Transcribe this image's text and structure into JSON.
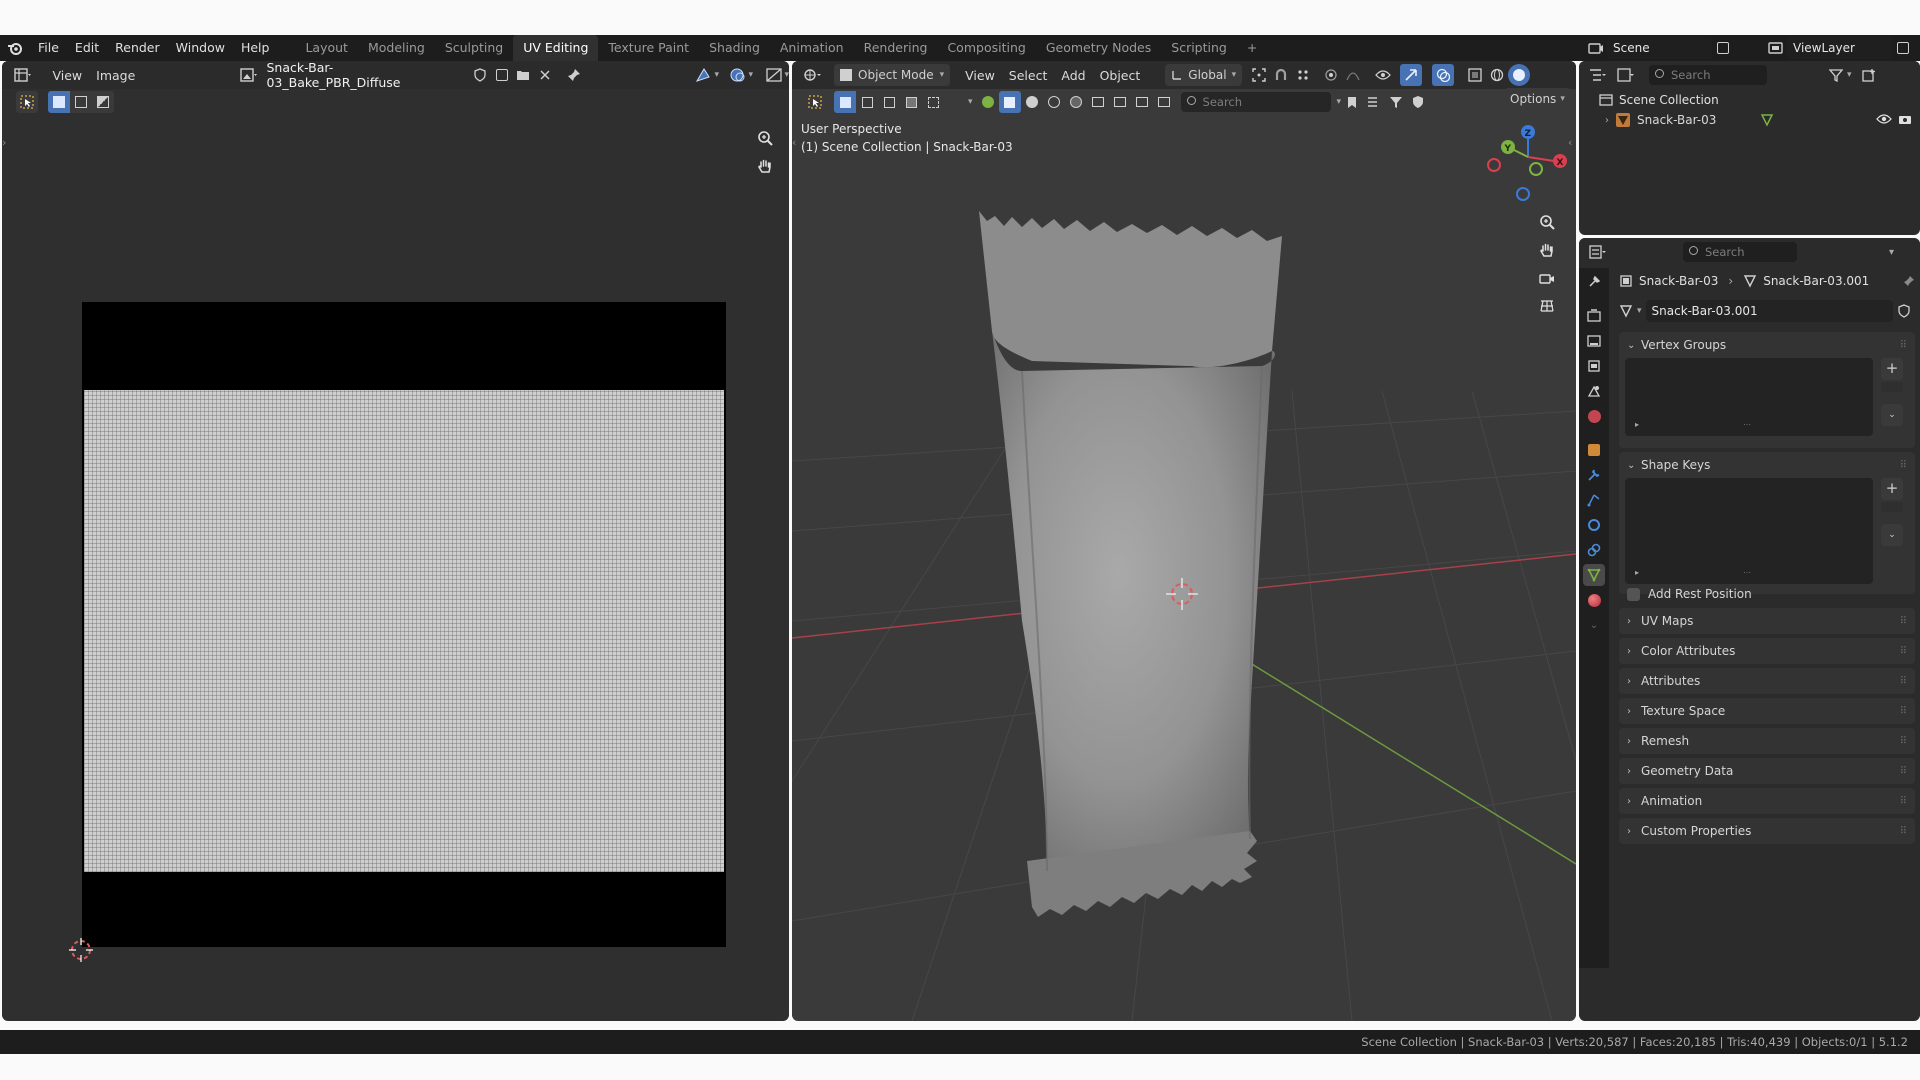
{
  "menubar": {
    "menus": [
      "File",
      "Edit",
      "Render",
      "Window",
      "Help"
    ],
    "workspaces": [
      "Layout",
      "Modeling",
      "Sculpting",
      "UV Editing",
      "Texture Paint",
      "Shading",
      "Animation",
      "Rendering",
      "Compositing",
      "Geometry Nodes",
      "Scripting"
    ],
    "active_workspace": "UV Editing",
    "add_tab": "+",
    "scene_name": "Scene",
    "view_layer": "ViewLayer"
  },
  "uv_editor": {
    "menus": [
      "View",
      "Image"
    ],
    "image_name": "Snack-Bar-03_Bake_PBR_Diffuse"
  },
  "viewport": {
    "mode": "Object Mode",
    "menus": [
      "View",
      "Select",
      "Add",
      "Object"
    ],
    "transform_orientation": "Global",
    "search_placeholder": "Search",
    "options_label": "Options",
    "perspective_label": "User Perspective",
    "collection_label": "(1) Scene Collection | Snack-Bar-03",
    "gizmo_axes": {
      "z": "Z",
      "y": "Y",
      "x": "X"
    }
  },
  "outliner": {
    "search_placeholder": "Search",
    "root": "Scene Collection",
    "items": [
      {
        "name": "Snack-Bar-03"
      }
    ]
  },
  "properties": {
    "search_placeholder": "Search",
    "breadcrumb": {
      "object": "Snack-Bar-03",
      "mesh": "Snack-Bar-03.001"
    },
    "datablock_name": "Snack-Bar-03.001",
    "panels_open": [
      {
        "label": "Vertex Groups"
      },
      {
        "label": "Shape Keys",
        "checkbox_label": "Add Rest Position"
      }
    ],
    "panels_closed": [
      "UV Maps",
      "Color Attributes",
      "Attributes",
      "Texture Space",
      "Remesh",
      "Geometry Data",
      "Animation",
      "Custom Properties"
    ]
  },
  "statusbar": {
    "text": "Scene Collection | Snack-Bar-03 | Verts:20,587 | Faces:20,185 | Tris:40,439 | Objects:0/1 | 5.1.2"
  },
  "colors": {
    "accent": "#4772b3",
    "axis_x": "#d9404f",
    "axis_y": "#7cb342",
    "axis_z": "#3b7ad8"
  }
}
